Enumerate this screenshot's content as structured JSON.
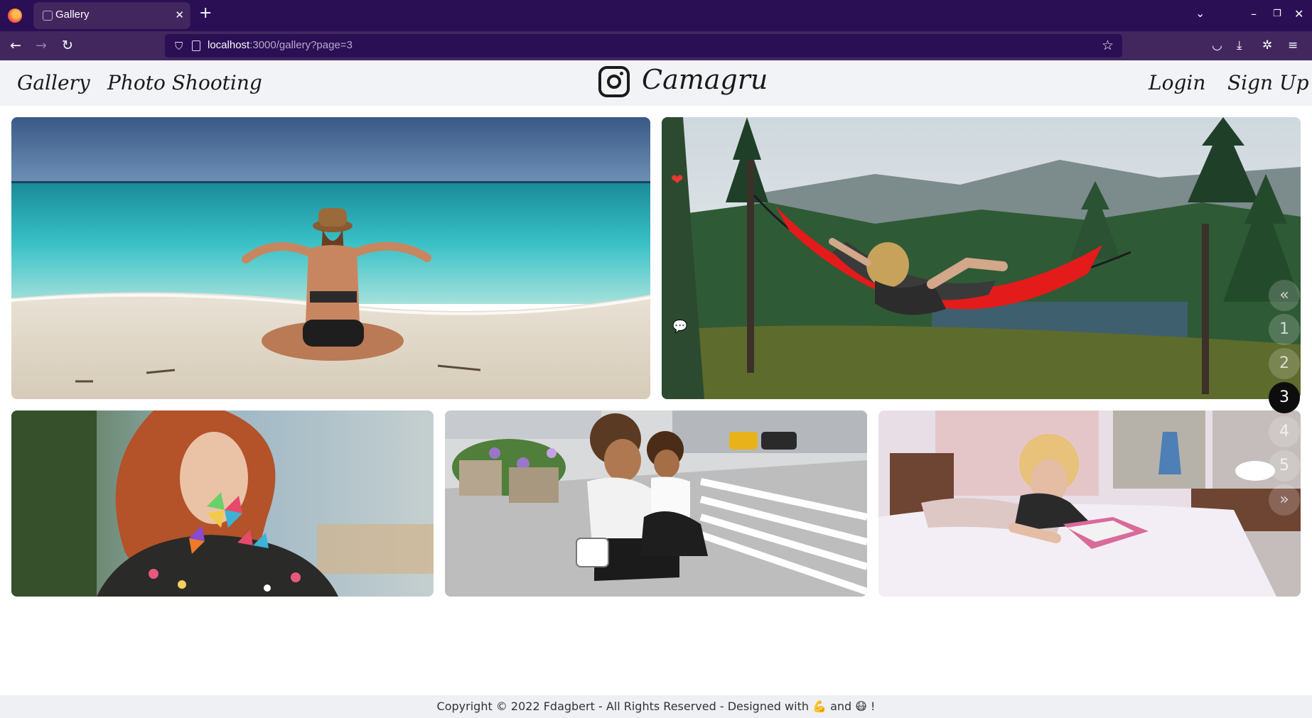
{
  "browser": {
    "tab_title": "Gallery",
    "tab_close": "✕",
    "new_tab": "+",
    "url_host": "localhost",
    "url_rest": ":3000/gallery?page=3",
    "icons": [
      "firefox-logo-icon",
      "back-icon",
      "forward-icon",
      "reload-icon",
      "shield-icon",
      "page-icon",
      "star-icon",
      "pocket-icon",
      "download-icon",
      "extensions-icon",
      "menu-icon",
      "tab-list-icon",
      "minimize-icon",
      "restore-icon",
      "close-icon"
    ]
  },
  "header": {
    "left_links": [
      "Gallery",
      "Photo Shooting"
    ],
    "brand": "Camagru",
    "right_links": [
      "Login",
      "Sign Up"
    ]
  },
  "gallery": {
    "photos": [
      {
        "name": "beach",
        "subject": "woman sitting on beach"
      },
      {
        "name": "hammock",
        "subject": "woman in red hammock in mountains"
      },
      {
        "name": "pinwheels",
        "subject": "red-haired woman with pinwheels"
      },
      {
        "name": "street",
        "subject": "mother and daughter on city street"
      },
      {
        "name": "bedroom",
        "subject": "woman reading magazine on bed"
      }
    ],
    "actions": {
      "heart": "❤",
      "comment": "💬"
    }
  },
  "pagination": {
    "prev": "«",
    "pages": [
      "1",
      "2",
      "3",
      "4",
      "5"
    ],
    "current": "3",
    "next": "»"
  },
  "footer": {
    "text": "Copyright © 2022 Fdagbert - All Rights Reserved - Designed with 💪 and 😷 !"
  },
  "colors": {
    "tabbar": "#2b0f55",
    "navbar": "#42275f",
    "header_bg": "#f1f3f6",
    "footer_bg": "#eef0f4",
    "active_page": "#0d0d0d",
    "heart": "#e53935"
  }
}
